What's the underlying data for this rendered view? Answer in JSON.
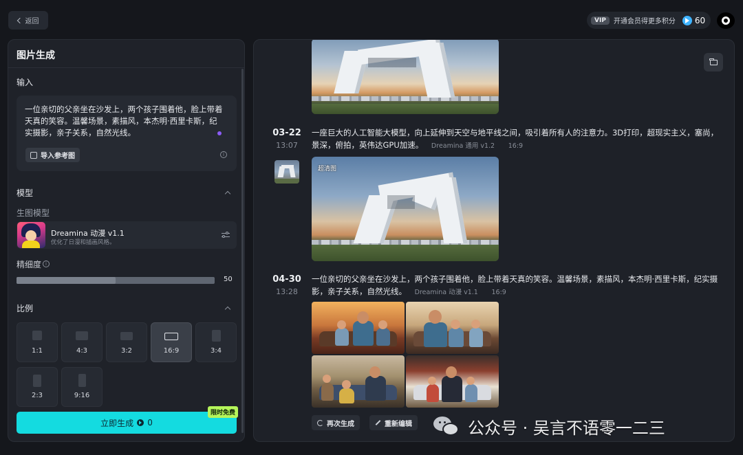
{
  "topbar": {
    "back_label": "返回",
    "vip_tag": "VIP",
    "vip_text": "开通会员得更多积分",
    "credits": "60"
  },
  "left": {
    "title": "图片生成",
    "input_label": "输入",
    "prompt": "一位亲切的父亲坐在沙发上，两个孩子围着他，脸上带着天真的笑容。温馨场景，素描风，本杰明·西里卡斯，纪实摄影，亲子关系，自然光线。",
    "ref_button": "导入参考图",
    "model_section": "模型",
    "model_sub": "生图模型",
    "model_name": "Dreamina 动漫 v1.1",
    "model_desc": "优化了日漫和插画风格。",
    "detail_label": "精细度",
    "detail_value": "50",
    "detail_fraction": 0.5,
    "ratio_section": "比例",
    "ratios": [
      "1:1",
      "4:3",
      "3:2",
      "16:9",
      "3:4",
      "2:3",
      "9:16"
    ],
    "selected_ratio": "16:9",
    "generate_label": "立即生成",
    "generate_cost": "0",
    "free_badge": "限时免费"
  },
  "feed": {
    "entries": [
      {
        "date": "03-22",
        "time": "13:07",
        "prompt": "一座巨大的人工智能大模型，向上延伸到天空与地平线之间，吸引着所有人的注意力。3D打印，超现实主义，塞尚，景深，俯拍，英伟达GPU加速。",
        "model": "Dreamina 通用 v1.2",
        "ratio": "16:9",
        "image_label": "超清图"
      },
      {
        "date": "04-30",
        "time": "13:28",
        "prompt": "一位亲切的父亲坐在沙发上，两个孩子围着他，脸上带着天真的笑容。温馨场景，素描风，本杰明·西里卡斯，纪实摄影，亲子关系，自然光线。",
        "model": "Dreamina 动漫 v1.1",
        "ratio": "16:9"
      }
    ],
    "actions": {
      "regenerate": "再次生成",
      "reedit": "重新编辑"
    }
  },
  "watermark": {
    "text": "公众号 · 吴言不语零一二三"
  },
  "colors": {
    "accent": "#14dbe0",
    "badge": "#b5f55a",
    "panel": "#1f2229",
    "background": "#15171c"
  }
}
